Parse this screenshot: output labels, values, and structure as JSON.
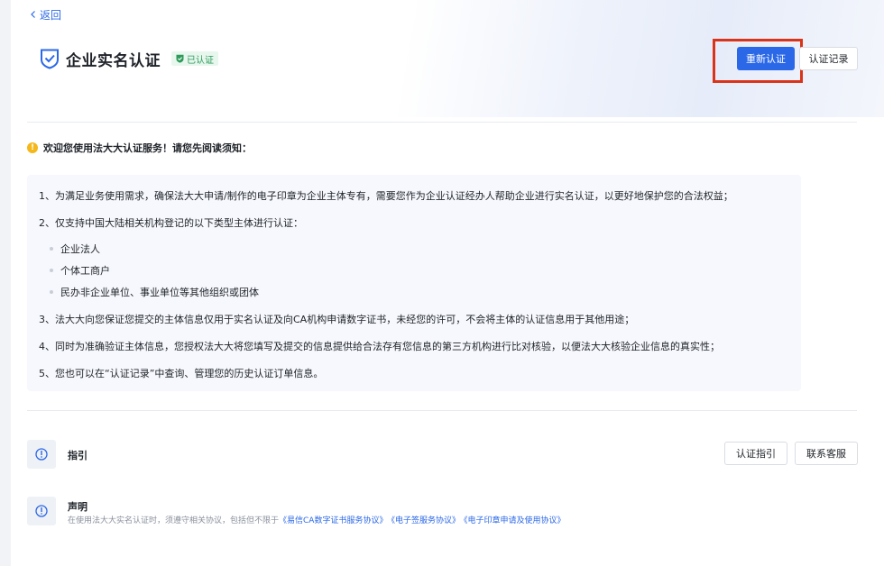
{
  "nav": {
    "back_label": "返回"
  },
  "header": {
    "title": "企业实名认证",
    "status_badge": "已认证",
    "reauth_button": "重新认证",
    "records_button": "认证记录",
    "colors": {
      "primary": "#2b68e8",
      "success": "#2e9a5a",
      "highlight": "#d9341a"
    }
  },
  "notice": {
    "header": "欢迎您使用法大大认证服务！请您先阅读须知：",
    "items": [
      "1、为满足业务使用需求，确保法大大申请/制作的电子印章为企业主体专有，需要您作为企业认证经办人帮助企业进行实名认证，以更好地保护您的合法权益；",
      "2、仅支持中国大陆相关机构登记的以下类型主体进行认证：",
      "3、法大大向您保证您提交的主体信息仅用于实名认证及向CA机构申请数字证书，未经您的许可，不会将主体的认证信息用于其他用途；",
      "4、同时为准确验证主体信息，您授权法大大将您填写及提交的信息提供给合法存有您信息的第三方机构进行比对核验，以便法大大核验企业信息的真实性；",
      "5、您也可以在“认证记录”中查询、管理您的历史认证订单信息。"
    ],
    "entity_types": [
      "企业法人",
      "个体工商户",
      "民办非企业单位、事业单位等其他组织或团体"
    ]
  },
  "guide": {
    "title": "指引",
    "guide_button": "认证指引",
    "support_button": "联系客服"
  },
  "statement": {
    "title": "声明",
    "text": "在使用法大大实名认证时，须遵守相关协议，包括但不限于",
    "links": [
      "《易信CA数字证书服务协议》",
      "《电子签服务协议》",
      "《电子印章申请及使用协议》"
    ]
  }
}
